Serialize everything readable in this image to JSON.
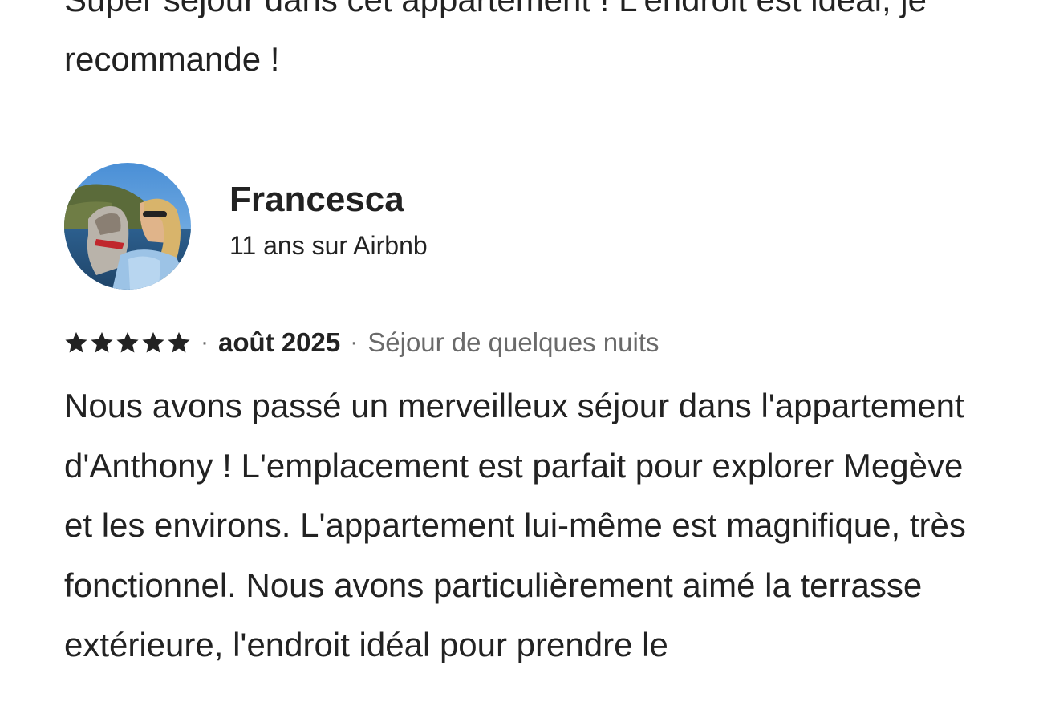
{
  "previous_review": {
    "text": "Super séjour dans cet appartement ! L'endroit est idéal, je recommande !"
  },
  "review": {
    "reviewer_name": "Francesca",
    "reviewer_tenure": "11 ans sur Airbnb",
    "rating": 5,
    "date": "août 2025",
    "stay_type": "Séjour de quelques nuits",
    "separator": "·",
    "text": "Nous avons passé un merveilleux séjour dans l'appartement d'Anthony ! L'emplacement est parfait pour explorer Megève et les environs. L'appartement lui-même est magnifique, très fonctionnel. Nous avons particulièrement aimé la terrasse extérieure, l'endroit idéal pour prendre le"
  },
  "icons": {
    "star": "star-icon",
    "avatar": "user-avatar-photo"
  },
  "colors": {
    "text_primary": "#222222",
    "text_secondary": "#6a6a6a",
    "background": "#ffffff"
  }
}
